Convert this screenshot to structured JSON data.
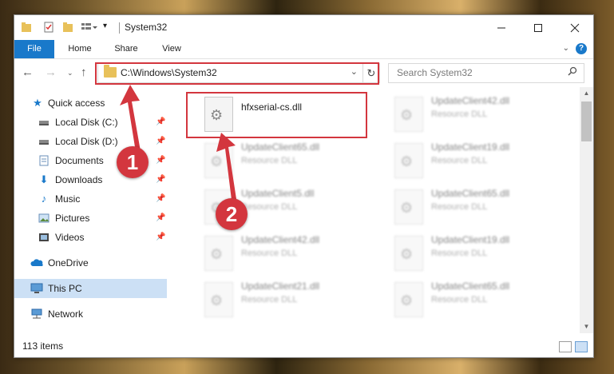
{
  "window": {
    "title": "System32",
    "controls": {
      "minimize": "—",
      "maximize": "☐",
      "close": "✕"
    }
  },
  "ribbon": {
    "tabs": [
      "File",
      "Home",
      "Share",
      "View"
    ]
  },
  "nav": {
    "address": "C:\\Windows\\System32",
    "search_placeholder": "Search System32"
  },
  "sidebar": {
    "items": [
      {
        "label": "Quick access",
        "icon": "star-icon",
        "pinned": false
      },
      {
        "label": "Local Disk (C:)",
        "icon": "drive-icon",
        "pinned": true
      },
      {
        "label": "Local Disk (D:)",
        "icon": "drive-icon",
        "pinned": true
      },
      {
        "label": "Documents",
        "icon": "documents-icon",
        "pinned": true
      },
      {
        "label": "Downloads",
        "icon": "downloads-icon",
        "pinned": true
      },
      {
        "label": "Music",
        "icon": "music-icon",
        "pinned": true
      },
      {
        "label": "Pictures",
        "icon": "pictures-icon",
        "pinned": true
      },
      {
        "label": "Videos",
        "icon": "videos-icon",
        "pinned": true
      },
      {
        "label": "OneDrive",
        "icon": "onedrive-icon",
        "pinned": false
      },
      {
        "label": "This PC",
        "icon": "this-pc-icon",
        "pinned": false,
        "selected": true
      },
      {
        "label": "Network",
        "icon": "network-icon",
        "pinned": false
      }
    ]
  },
  "files": {
    "highlighted": {
      "name": "hfxserial-cs.dll"
    },
    "left_column": [
      {
        "name": "UpdateClient65.dll",
        "type": "Resource DLL"
      },
      {
        "name": "UpdateClient5.dll",
        "type": "Resource DLL"
      },
      {
        "name": "UpdateClient42.dll",
        "type": "Resource DLL"
      },
      {
        "name": "UpdateClient21.dll",
        "type": "Resource DLL"
      }
    ],
    "right_column": [
      {
        "name": "UpdateClient42.dll",
        "type": "Resource DLL"
      },
      {
        "name": "UpdateClient19.dll",
        "type": "Resource DLL"
      },
      {
        "name": "UpdateClient65.dll",
        "type": "Resource DLL"
      },
      {
        "name": "UpdateClient19.dll",
        "type": "Resource DLL"
      },
      {
        "name": "UpdateClient65.dll",
        "type": "Resource DLL"
      }
    ]
  },
  "status": {
    "item_count": "113 items"
  },
  "annotations": {
    "step1": "1",
    "step2": "2",
    "accent_color": "#d3363e"
  }
}
